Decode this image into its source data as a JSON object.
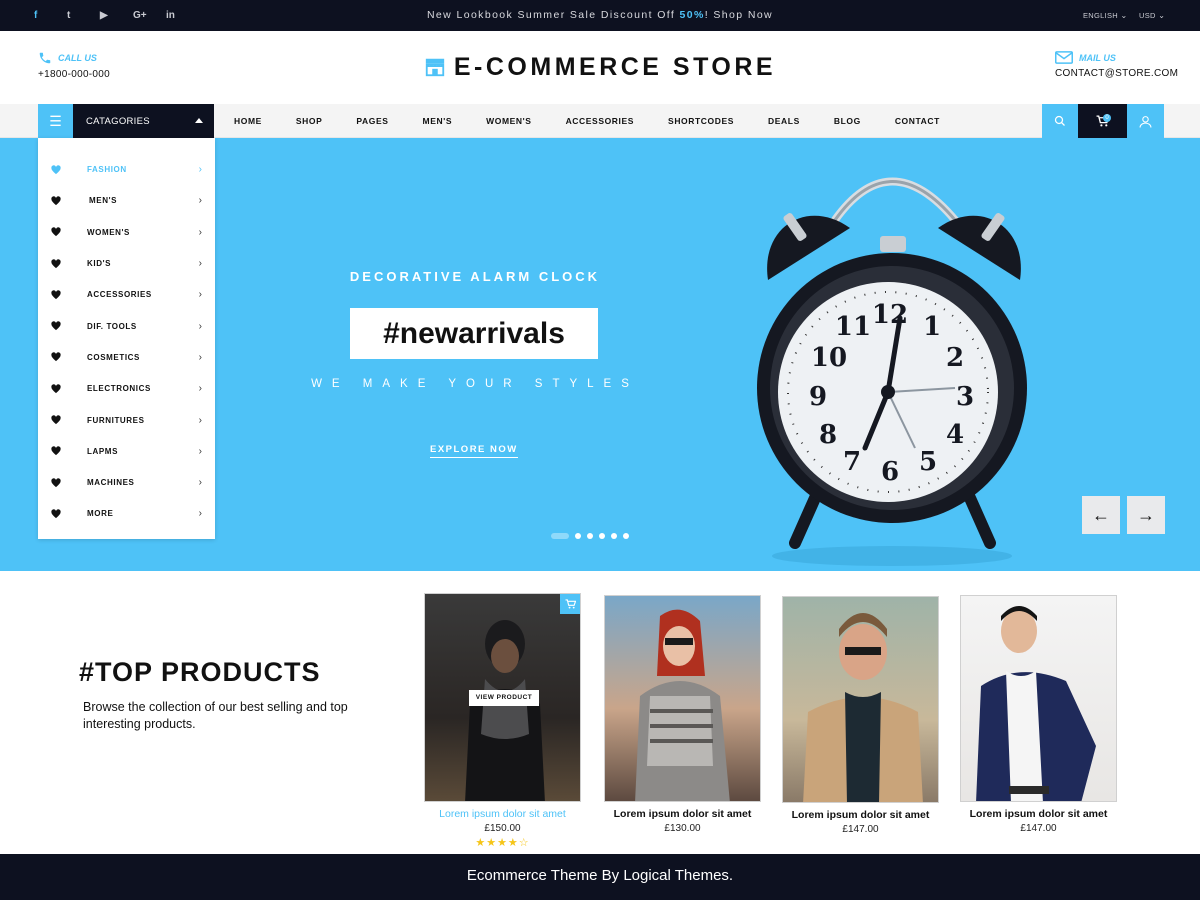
{
  "topbar": {
    "social": [
      {
        "name": "facebook-icon",
        "glyph": "f"
      },
      {
        "name": "twitter-icon",
        "glyph": "t"
      },
      {
        "name": "youtube-icon",
        "glyph": "▶"
      },
      {
        "name": "google-plus-icon",
        "glyph": "G+"
      },
      {
        "name": "linkedin-icon",
        "glyph": "in"
      }
    ],
    "promo_before": "New Lookbook Summer Sale Discount Off ",
    "promo_highlight": "50%",
    "promo_after": "! Shop Now",
    "language": "ENGLISH",
    "currency": "USD"
  },
  "header": {
    "call_label": "CALL US",
    "call_value": "+1800-000-000",
    "logo": "E-COMMERCE STORE",
    "mail_label": "MAIL US",
    "mail_value": "CONTACT@STORE.COM"
  },
  "nav": {
    "categories_label": "CATAGORIES",
    "menu": [
      "HOME",
      "SHOP",
      "PAGES",
      "MEN'S",
      "WOMEN'S",
      "ACCESSORIES",
      "SHORTCODES",
      "DEALS",
      "BLOG",
      "CONTACT"
    ],
    "cart_count": "0"
  },
  "sidebar": {
    "items": [
      "FASHION",
      "MEN'S",
      "WOMEN'S",
      "KID'S",
      "ACCESSORIES",
      "DIF. TOOLS",
      "COSMETICS",
      "ELECTRONICS",
      "FURNITURES",
      "LAPMS",
      "MACHINES",
      "MORE"
    ]
  },
  "hero": {
    "subtitle": "DECORATIVE ALARM CLOCK",
    "tag": "#newarrivals",
    "tagline": "WE MAKE YOUR STYLES",
    "button": "EXPLORE NOW",
    "prev": "←",
    "next": "→",
    "clock_numerals": [
      "12",
      "1",
      "2",
      "3",
      "4",
      "5",
      "6",
      "7",
      "8",
      "9",
      "10",
      "11"
    ]
  },
  "top_products": {
    "title": "#TOP PRODUCTS",
    "description": "Browse the collection of our best selling and top interesting products.",
    "view_label": "VIEW PRODUCT",
    "products": [
      {
        "name": "Lorem ipsum dolor sit amet",
        "price": "£150.00",
        "rating": "★★★★☆"
      },
      {
        "name": "Lorem ipsum dolor sit amet",
        "price": "£130.00"
      },
      {
        "name": "Lorem ipsum dolor sit amet",
        "price": "£147.00"
      },
      {
        "name": "Lorem ipsum dolor sit amet",
        "price": "£147.00"
      }
    ]
  },
  "footer": {
    "text": "Ecommerce Theme By Logical Themes."
  },
  "colors": {
    "accent": "#4ec2f7",
    "dark": "#0d1120"
  }
}
